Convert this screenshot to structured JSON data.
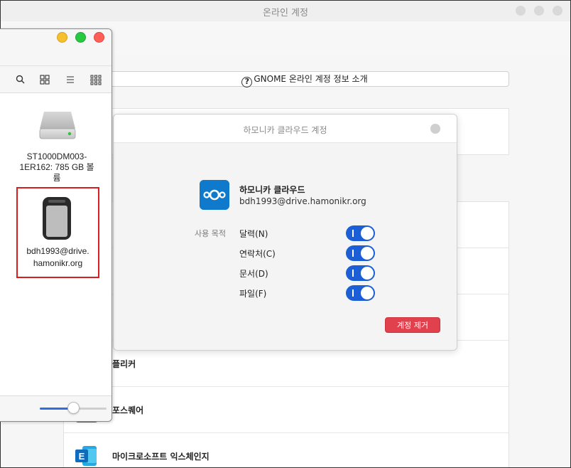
{
  "main_window": {
    "title": "온라인 계정",
    "about_link": "GNOME 온라인 계정 정보 소개",
    "providers": [
      {
        "label": "플리커",
        "icon": "flickr-icon"
      },
      {
        "label": "포스퀘어",
        "icon": "foursquare-icon"
      },
      {
        "label": "마이크로소프트 익스체인지",
        "icon": "exchange-icon"
      }
    ]
  },
  "dialog": {
    "title": "하모니카 클라우드 계정",
    "account_name": "하모니카 클라우드",
    "account_email": "bdh1993@drive.hamonikr.org",
    "usage_label": "사용 목적",
    "services": [
      {
        "label": "달력(N)",
        "enabled": true
      },
      {
        "label": "연락처(C)",
        "enabled": true
      },
      {
        "label": "문서(D)",
        "enabled": true
      },
      {
        "label": "파일(F)",
        "enabled": true
      }
    ],
    "remove_button": "계정 제거",
    "colors": {
      "toggle_on": "#1c5ed6",
      "remove": "#e0414d",
      "logo": "#0f7acb"
    }
  },
  "finder": {
    "items": [
      {
        "label_line1": "ST1000DM003-",
        "label_line2": "1ER162: 785 GB 볼",
        "label_line3": "륨",
        "icon": "hard-drive-icon"
      },
      {
        "label_line1": "bdh1993@drive.",
        "label_line2": "hamonikr.org",
        "icon": "network-drive-icon"
      }
    ],
    "icon_size_slider": 0.5,
    "traffic_lights": {
      "minimize": "#f5bf2e",
      "maximize": "#28c840",
      "close": "#ff5f57"
    }
  }
}
